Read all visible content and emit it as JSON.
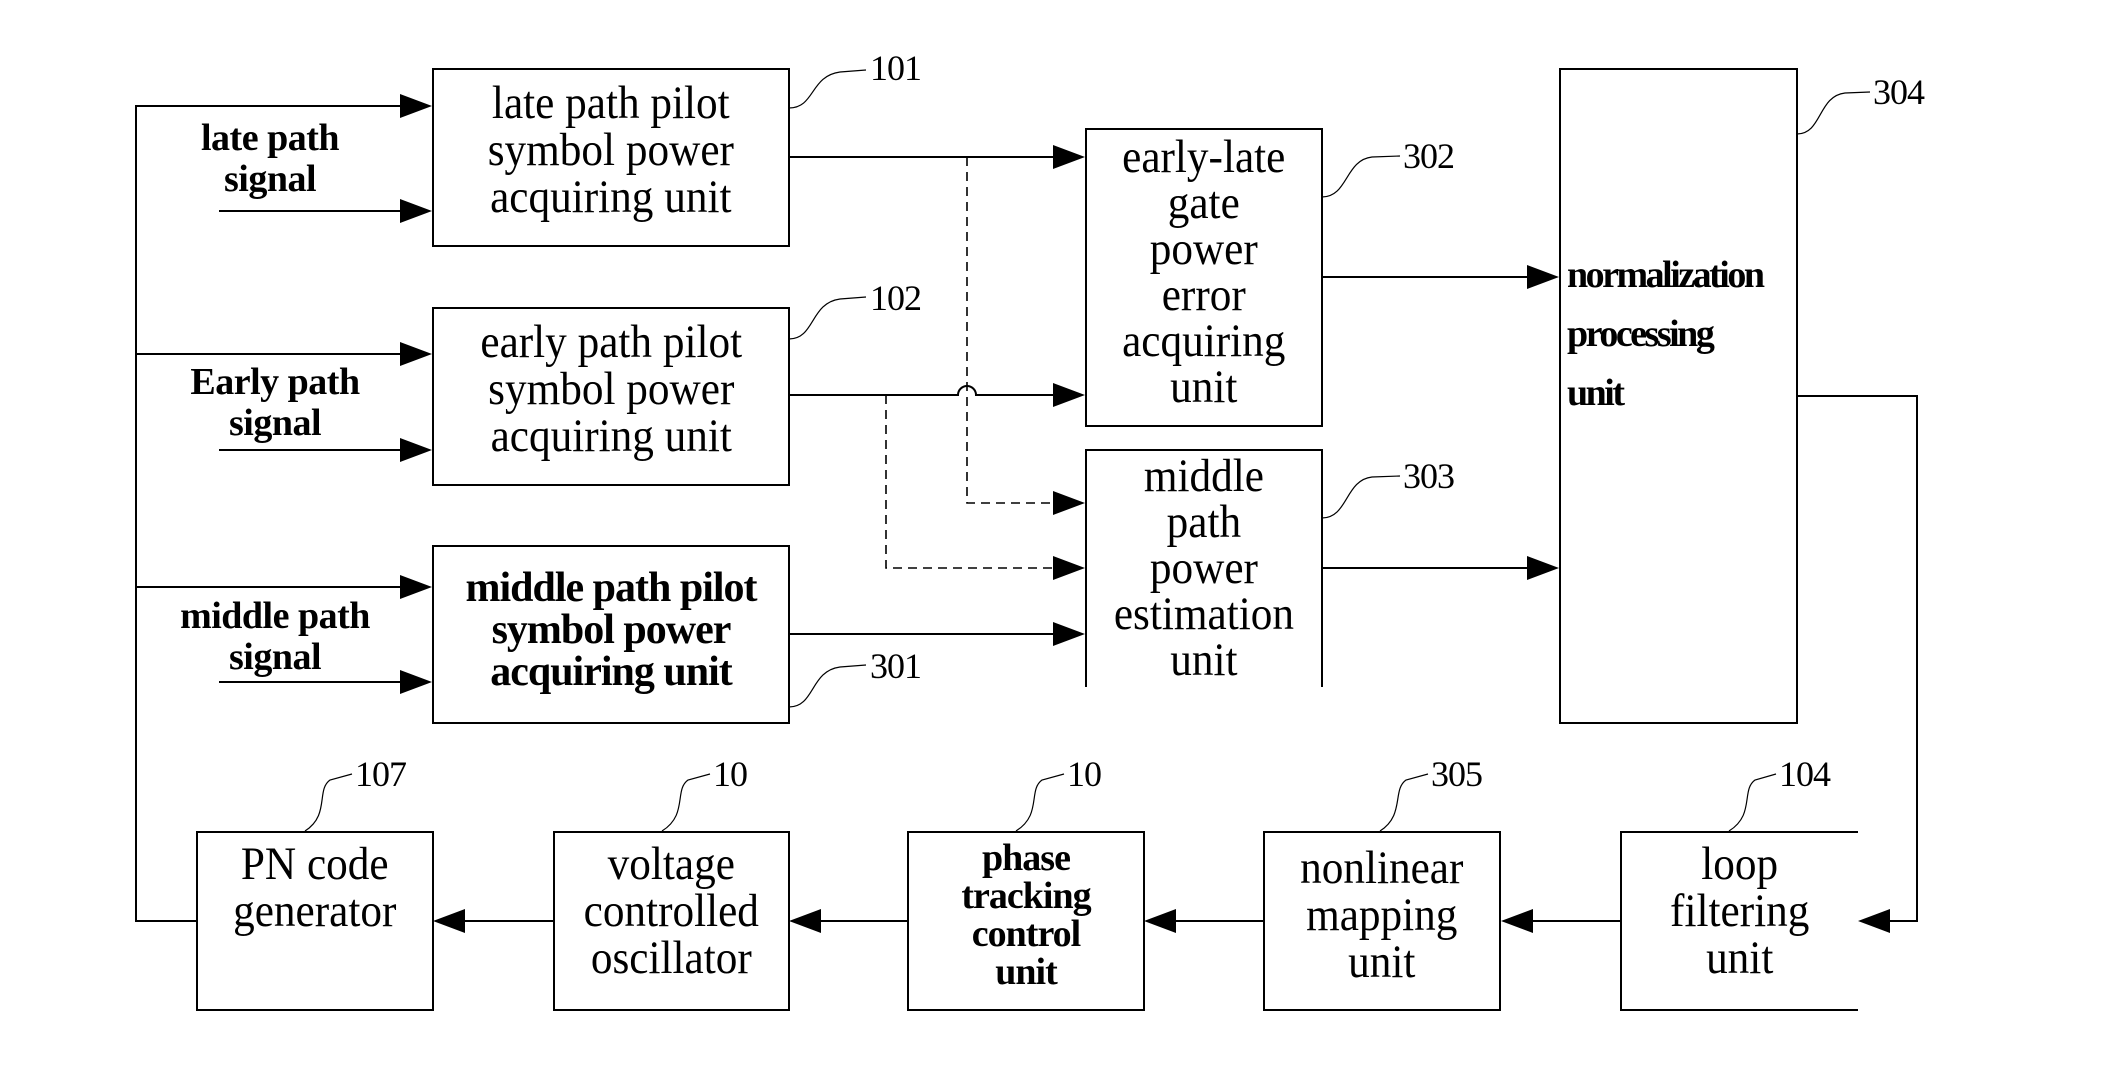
{
  "diagram": {
    "type": "block-diagram",
    "subject": "PN code phase tracking loop",
    "input_signals": [
      {
        "id": "late",
        "label": "late path\nsignal"
      },
      {
        "id": "early",
        "label": "Early path\nsignal"
      },
      {
        "id": "middle",
        "label": "middle path\nsignal"
      }
    ],
    "blocks": {
      "b101": {
        "ref": "101",
        "label": "late path pilot\nsymbol power\nacquiring unit"
      },
      "b102": {
        "ref": "102",
        "label": "early path pilot\nsymbol power\nacquiring unit"
      },
      "b301": {
        "ref": "301",
        "label": "middle path pilot\nsymbol power\nacquiring unit"
      },
      "b302": {
        "ref": "302",
        "label": "early-late\ngate\npower\nerror\nacquiring\nunit"
      },
      "b303": {
        "ref": "303",
        "label": "middle\npath\npower\nestimation\nunit"
      },
      "b304": {
        "ref": "304",
        "label": "normalization\nprocessing\nunit"
      },
      "b104": {
        "ref": "104",
        "label": "loop\nfiltering\nunit"
      },
      "b305": {
        "ref": "305",
        "label": "nonlinear\nmapping\nunit"
      },
      "b105": {
        "ref": "10",
        "label": "phase\ntracking\ncontrol\nunit"
      },
      "b106": {
        "ref": "10",
        "label": "voltage\ncontrolled\noscillator"
      },
      "b107": {
        "ref": "107",
        "label": "PN code\ngenerator"
      }
    },
    "connections": [
      {
        "from": "b107",
        "to": [
          "b101",
          "b102",
          "b301"
        ],
        "style": "solid"
      },
      {
        "from": "late_signal",
        "to": "b101",
        "style": "solid"
      },
      {
        "from": "early_signal",
        "to": "b102",
        "style": "solid"
      },
      {
        "from": "middle_signal",
        "to": "b301",
        "style": "solid"
      },
      {
        "from": "b101",
        "to": "b302",
        "style": "solid"
      },
      {
        "from": "b102",
        "to": "b302",
        "style": "solid"
      },
      {
        "from": "b101",
        "to": "b303",
        "style": "dashed"
      },
      {
        "from": "b102",
        "to": "b303",
        "style": "dashed"
      },
      {
        "from": "b301",
        "to": "b303",
        "style": "solid"
      },
      {
        "from": "b302",
        "to": "b304",
        "style": "solid"
      },
      {
        "from": "b303",
        "to": "b304",
        "style": "solid"
      },
      {
        "from": "b304",
        "to": "b104",
        "style": "solid"
      },
      {
        "from": "b104",
        "to": "b305",
        "style": "solid"
      },
      {
        "from": "b305",
        "to": "b105",
        "style": "solid"
      },
      {
        "from": "b105",
        "to": "b106",
        "style": "solid"
      },
      {
        "from": "b106",
        "to": "b107",
        "style": "solid"
      }
    ]
  }
}
